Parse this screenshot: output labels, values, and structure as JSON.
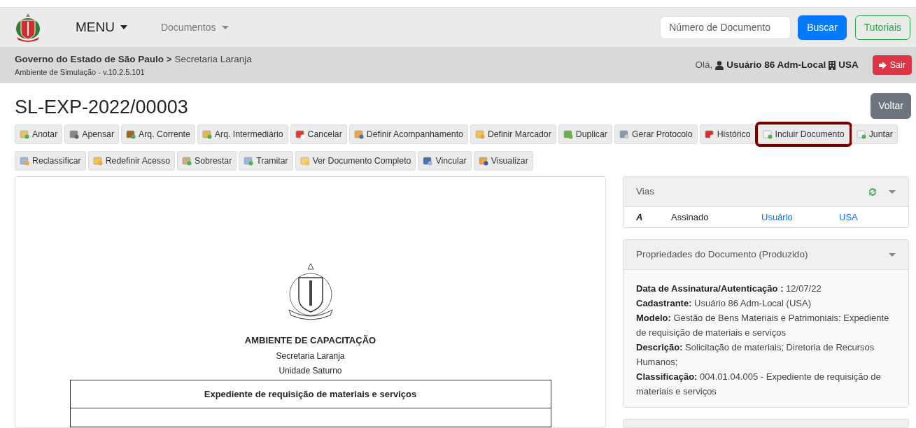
{
  "navbar": {
    "menu": "MENU",
    "documents": "Documentos",
    "search": {
      "placeholder": "Número de Documento"
    },
    "search_button": "Buscar",
    "tutorials_button": "Tutoriais"
  },
  "context_bar": {
    "organization": "Governo do Estado de São Paulo",
    "separator": ">",
    "department": "Secretaria Laranja",
    "environment": "Ambiente de Simulação - v.10.2.5.101",
    "greeting": "Olá,",
    "user": "Usuário 86 Adm-Local",
    "unit": "USA",
    "logout": "Sair"
  },
  "title": "SL-EXP-2022/00003",
  "back_button": "Voltar",
  "actions": [
    {
      "label": "Anotar",
      "highlighted": false
    },
    {
      "label": "Apensar",
      "highlighted": false
    },
    {
      "label": "Arq. Corrente",
      "highlighted": false
    },
    {
      "label": "Arq. Intermediário",
      "highlighted": false
    },
    {
      "label": "Cancelar",
      "highlighted": false
    },
    {
      "label": "Definir Acompanhamento",
      "highlighted": false
    },
    {
      "label": "Definir Marcador",
      "highlighted": false
    },
    {
      "label": "Duplicar",
      "highlighted": false
    },
    {
      "label": "Gerar Protocolo",
      "highlighted": false
    },
    {
      "label": "Histórico",
      "highlighted": false
    },
    {
      "label": "Incluir Documento",
      "highlighted": true
    },
    {
      "label": "Juntar",
      "highlighted": false
    },
    {
      "label": "Reclassificar",
      "highlighted": false
    },
    {
      "label": "Redefinir Acesso",
      "highlighted": false
    },
    {
      "label": "Sobrestar",
      "highlighted": false
    },
    {
      "label": "Tramitar",
      "highlighted": false
    },
    {
      "label": "Ver Documento Completo",
      "highlighted": false
    },
    {
      "label": "Vincular",
      "highlighted": false
    },
    {
      "label": "Visualizar",
      "highlighted": false
    }
  ],
  "document": {
    "header": "AMBIENTE DE CAPACITAÇÃO",
    "department": "Secretaria Laranja",
    "unit": "Unidade Saturno",
    "form_title": "Expediente de requisição de materiais e serviços"
  },
  "vias": {
    "title": "Vias",
    "rows": [
      {
        "letter": "A",
        "status": "Assinado",
        "user": "Usuário",
        "unit": "USA"
      }
    ]
  },
  "properties": {
    "title": "Propriedades do Documento (Produzido)",
    "items": [
      {
        "label": "Data de Assinatura/Autenticação :",
        "value": "12/07/22"
      },
      {
        "label": "Cadastrante:",
        "value": "Usuário 86 Adm-Local (USA)"
      },
      {
        "label": "Modelo:",
        "value": "Gestão de Bens Materiais e Patrimoniais: Expediente de requisição de materiais e serviços"
      },
      {
        "label": "Descrição:",
        "value": "Solicitação de materiais; Diretoria de Recursos Humanos;"
      },
      {
        "label": "Classificação:",
        "value": "004.01.04.005 - Expediente de requisição de materiais e serviços"
      }
    ]
  }
}
